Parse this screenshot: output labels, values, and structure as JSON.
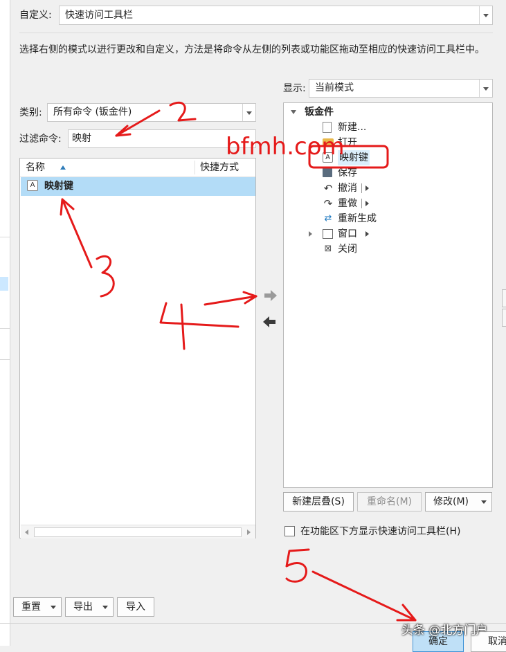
{
  "customize": {
    "label": "自定义:",
    "value": "快速访问工具栏"
  },
  "description": "选择右侧的模式以进行更改和自定义，方法是将命令从左侧的列表或功能区拖动至相应的快速访问工具栏中。",
  "display": {
    "label": "显示:",
    "value": "当前模式"
  },
  "category": {
    "label": "类别:",
    "value": "所有命令 (钣金件)"
  },
  "filter": {
    "label": "过滤命令:",
    "value": "映射"
  },
  "command_list": {
    "columns": [
      "名称",
      "快捷方式"
    ],
    "rows": [
      {
        "name": "映射键",
        "shortcut": ""
      }
    ]
  },
  "tree": {
    "root": "钣金件",
    "items": [
      {
        "label": "新建...",
        "icon": "new-file-icon"
      },
      {
        "label": "打开",
        "icon": "open-folder-icon"
      },
      {
        "label": "映射键",
        "icon": "mapkey-icon"
      },
      {
        "label": "保存",
        "icon": "save-icon"
      },
      {
        "label": "撤消",
        "icon": "undo-icon"
      },
      {
        "label": "重做",
        "icon": "redo-icon"
      },
      {
        "label": "重新生成",
        "icon": "regenerate-icon"
      },
      {
        "label": "窗口",
        "icon": "window-icon"
      },
      {
        "label": "关闭",
        "icon": "close-window-icon"
      }
    ]
  },
  "buttons": {
    "new_cascade": "新建层叠(S)",
    "rename": "重命名(M)",
    "modify": "修改(M)",
    "reset": "重置",
    "export": "导出",
    "import": "导入",
    "ok": "确定",
    "cancel": "取消"
  },
  "checkbox": {
    "label": "在功能区下方显示快速访问工具栏(H)",
    "checked": false
  },
  "watermark": "bfmh.com",
  "annotation_numbers": [
    "2",
    "3",
    "4",
    "5"
  ],
  "footer_watermark": "头条 @北方门户",
  "colors": {
    "selection": "#b3dcf7",
    "annotation": "#e51a1a",
    "ok_button": "#bfe0f7"
  }
}
